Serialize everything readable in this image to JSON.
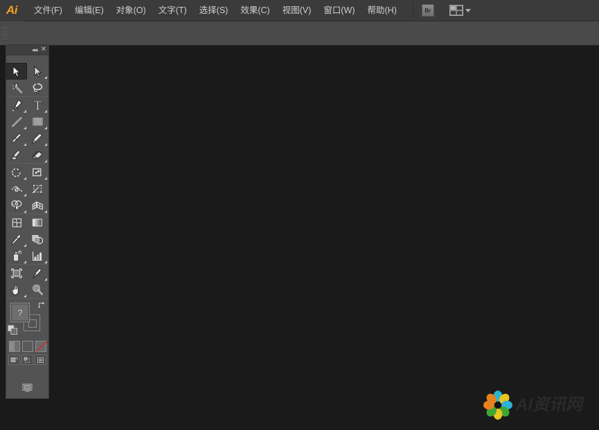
{
  "app": {
    "name": "Adobe Illustrator",
    "logo_text": "Ai",
    "logo_color": "#f0a21e"
  },
  "menubar": {
    "items": [
      {
        "label": "文件(F)",
        "name": "menu-file"
      },
      {
        "label": "编辑(E)",
        "name": "menu-edit"
      },
      {
        "label": "对象(O)",
        "name": "menu-object"
      },
      {
        "label": "文字(T)",
        "name": "menu-type"
      },
      {
        "label": "选择(S)",
        "name": "menu-select"
      },
      {
        "label": "效果(C)",
        "name": "menu-effect"
      },
      {
        "label": "视图(V)",
        "name": "menu-view"
      },
      {
        "label": "窗口(W)",
        "name": "menu-window"
      },
      {
        "label": "帮助(H)",
        "name": "menu-help"
      }
    ],
    "bridge_button_label": "Br",
    "arrange_documents_icon": "arrange-documents-icon",
    "dropdown_icon": "chevron-down-icon"
  },
  "controlbar": {
    "grip_icon": "drag-grip-icon",
    "content": ""
  },
  "toolpanel": {
    "header": {
      "collapse_icon": "double-chevron-left-icon",
      "collapse_label": "◂◂",
      "close_icon": "close-icon",
      "close_label": "✕",
      "grip_icon": "drag-grip-icon"
    },
    "tools": [
      {
        "name": "selection-tool",
        "label": "选择工具",
        "selected": true,
        "flyout": false
      },
      {
        "name": "direct-selection-tool",
        "label": "直接选择工具",
        "selected": false,
        "flyout": true
      },
      {
        "name": "magic-wand-tool",
        "label": "魔棒工具",
        "selected": false,
        "flyout": false
      },
      {
        "name": "lasso-tool",
        "label": "套索工具",
        "selected": false,
        "flyout": false
      },
      {
        "name": "pen-tool",
        "label": "钢笔工具",
        "selected": false,
        "flyout": true
      },
      {
        "name": "type-tool",
        "label": "文字工具",
        "selected": false,
        "flyout": true
      },
      {
        "name": "line-segment-tool",
        "label": "直线段工具",
        "selected": false,
        "flyout": true
      },
      {
        "name": "rectangle-tool",
        "label": "矩形工具",
        "selected": false,
        "flyout": true
      },
      {
        "name": "paintbrush-tool",
        "label": "画笔工具",
        "selected": false,
        "flyout": true
      },
      {
        "name": "pencil-tool",
        "label": "铅笔工具",
        "selected": false,
        "flyout": true
      },
      {
        "name": "blob-brush-tool",
        "label": "斑点画笔工具",
        "selected": false,
        "flyout": false
      },
      {
        "name": "eraser-tool",
        "label": "橡皮擦工具",
        "selected": false,
        "flyout": true
      },
      {
        "name": "rotate-tool",
        "label": "旋转工具",
        "selected": false,
        "flyout": true
      },
      {
        "name": "scale-tool",
        "label": "比例缩放工具",
        "selected": false,
        "flyout": true
      },
      {
        "name": "width-tool",
        "label": "宽度工具",
        "selected": false,
        "flyout": true
      },
      {
        "name": "free-transform-tool",
        "label": "自由变换工具",
        "selected": false,
        "flyout": false
      },
      {
        "name": "shape-builder-tool",
        "label": "形状生成器工具",
        "selected": false,
        "flyout": true
      },
      {
        "name": "perspective-grid-tool",
        "label": "透视网格工具",
        "selected": false,
        "flyout": true
      },
      {
        "name": "mesh-tool",
        "label": "网格工具",
        "selected": false,
        "flyout": false
      },
      {
        "name": "gradient-tool",
        "label": "渐变工具",
        "selected": false,
        "flyout": false
      },
      {
        "name": "eyedropper-tool",
        "label": "吸管工具",
        "selected": false,
        "flyout": true
      },
      {
        "name": "blend-tool",
        "label": "混合工具",
        "selected": false,
        "flyout": false
      },
      {
        "name": "symbol-sprayer-tool",
        "label": "符号喷枪工具",
        "selected": false,
        "flyout": true
      },
      {
        "name": "column-graph-tool",
        "label": "柱形图工具",
        "selected": false,
        "flyout": true
      },
      {
        "name": "artboard-tool",
        "label": "画板工具",
        "selected": false,
        "flyout": false
      },
      {
        "name": "slice-tool",
        "label": "切片工具",
        "selected": false,
        "flyout": true
      },
      {
        "name": "hand-tool",
        "label": "抓手工具",
        "selected": false,
        "flyout": true
      },
      {
        "name": "zoom-tool",
        "label": "缩放工具",
        "selected": false,
        "flyout": false
      }
    ],
    "fill_stroke": {
      "fill_label": "?",
      "fill_name": "fill-swatch",
      "stroke_name": "stroke-swatch",
      "swap_icon": "swap-fill-stroke-icon",
      "default_icon": "default-fill-stroke-icon"
    },
    "color_modes": [
      {
        "name": "color-mode-button",
        "label": "颜色"
      },
      {
        "name": "gradient-mode-button",
        "label": "渐变"
      },
      {
        "name": "none-mode-button",
        "label": "无"
      }
    ],
    "draw_modes": [
      {
        "name": "draw-normal-button",
        "label": "正常绘图"
      },
      {
        "name": "draw-behind-button",
        "label": "背面绘图"
      },
      {
        "name": "draw-inside-button",
        "label": "内部绘图"
      }
    ],
    "screen_mode": {
      "name": "screen-mode-button",
      "label": "更改屏幕模式"
    }
  },
  "canvas": {
    "background_color": "#1a1a1a",
    "document_open": false
  },
  "watermark": {
    "text": "AI资讯网",
    "logo_name": "flower-logo-icon",
    "petal_colors": [
      "#2bb3d6",
      "#3fa535",
      "#e8821e",
      "#e8c61e",
      "#2bb3d6",
      "#3fa535",
      "#e8821e",
      "#e8c61e"
    ]
  },
  "colors": {
    "menubar_bg": "#3b3b3b",
    "controlbar_bg": "#4a4a4a",
    "panel_bg": "#535353",
    "canvas_bg": "#1a1a1a",
    "text": "#cfcfcf",
    "accent": "#f0a21e"
  }
}
